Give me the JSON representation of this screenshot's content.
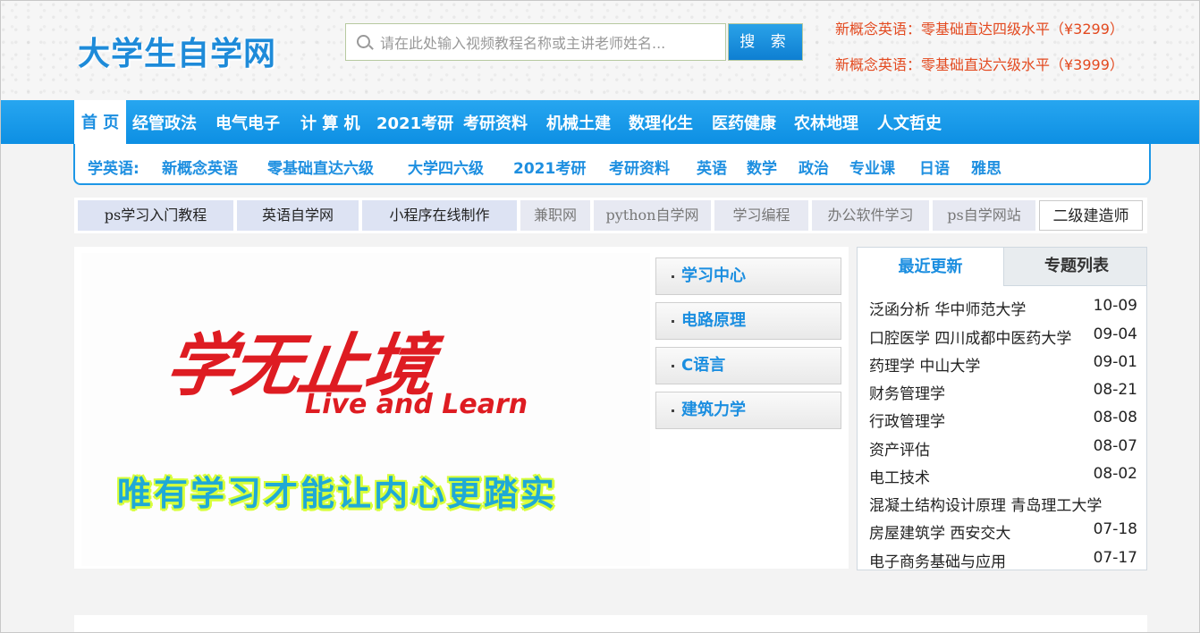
{
  "header": {
    "logo": "大学生自学网",
    "search_placeholder": "请在此处输入视频教程名称或主讲老师姓名...",
    "search_button": "搜 索",
    "promos": [
      "新概念英语：零基础直达四级水平（¥3299）",
      "新概念英语：零基础直达六级水平（¥3999）"
    ]
  },
  "nav": {
    "home": "首 页",
    "items": [
      "经管政法",
      "电气电子",
      "计 算 机",
      "2021考研",
      "考研资料",
      "机械土建",
      "数理化生",
      "医药健康",
      "农林地理",
      "人文哲史"
    ]
  },
  "subnav": {
    "label": "学英语:",
    "items": [
      "新概念英语",
      "零基础直达六级",
      "大学四六级",
      "2021考研",
      "考研资料",
      "英语",
      "数学",
      "政治",
      "专业课",
      "日语",
      "雅思"
    ]
  },
  "links": [
    "ps学习入门教程",
    "英语自学网",
    "小程序在线制作",
    "兼职网",
    "python自学网",
    "学习编程",
    "办公软件学习",
    "ps自学网站",
    "二级建造师"
  ],
  "banner": {
    "title": "学无止境",
    "subtitle": "Live and Learn",
    "slogan": "唯有学习才能让内心更踏实"
  },
  "categories": [
    "学习中心",
    "电路原理",
    "C语言",
    "建筑力学"
  ],
  "side_panel": {
    "tabs": [
      "最近更新",
      "专题列表"
    ],
    "rows": [
      {
        "title": "泛函分析 华中师范大学",
        "date": "10-09"
      },
      {
        "title": "口腔医学 四川成都中医药大学",
        "date": "09-04"
      },
      {
        "title": "药理学 中山大学",
        "date": "09-01"
      },
      {
        "title": "财务管理学",
        "date": "08-21"
      },
      {
        "title": "行政管理学",
        "date": "08-08"
      },
      {
        "title": "资产评估",
        "date": "08-07"
      },
      {
        "title": "电工技术",
        "date": "08-02"
      },
      {
        "title": "混凝土结构设计原理 青岛理工大学",
        "date": ""
      },
      {
        "title": "房屋建筑学 西安交大",
        "date": "07-18"
      },
      {
        "title": "电子商务基础与应用",
        "date": "07-17"
      }
    ]
  }
}
